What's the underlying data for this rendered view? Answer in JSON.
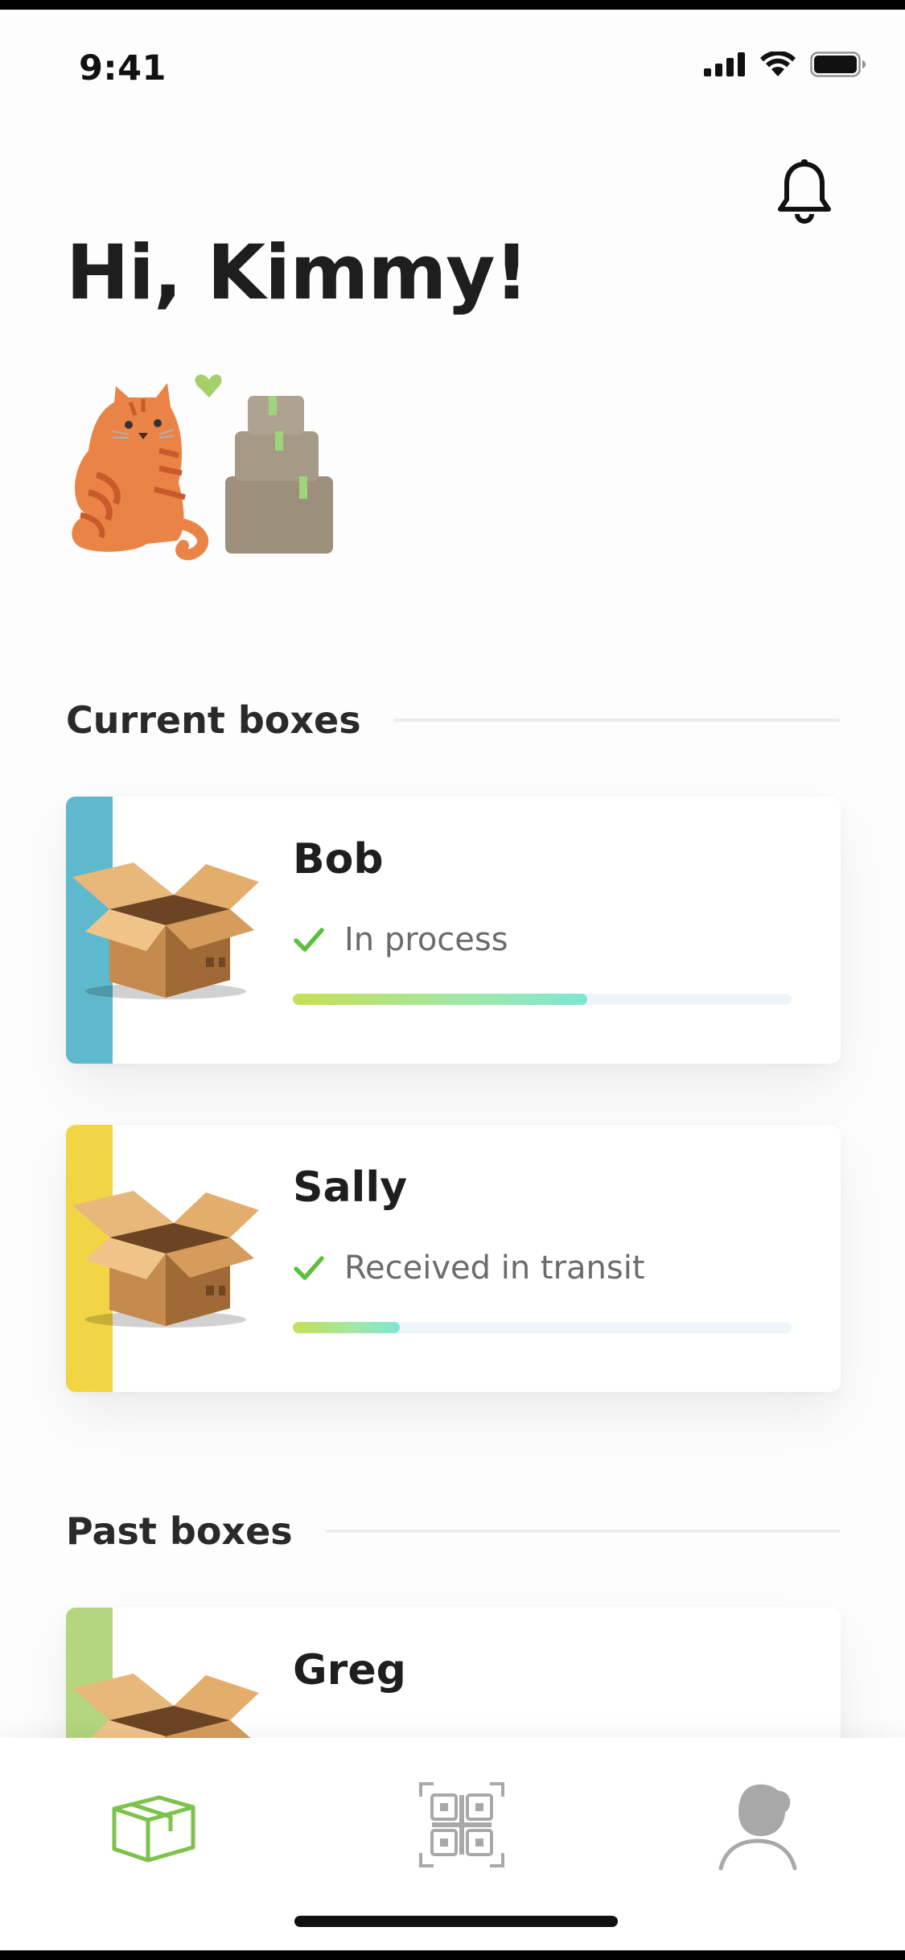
{
  "status_bar": {
    "time": "9:41",
    "icons": [
      "cellular-signal-icon",
      "wifi-icon",
      "battery-icon"
    ]
  },
  "header": {
    "greeting": "Hi, Kimmy!",
    "notification_icon": "bell-icon"
  },
  "illustration": "cat-with-boxes-illustration",
  "sections": {
    "current_title": "Current boxes",
    "past_title": "Past boxes"
  },
  "current_boxes": [
    {
      "name": "Bob",
      "status": "In process",
      "progress": 0.59,
      "accent_color": "#5fb9cc"
    },
    {
      "name": "Sally",
      "status": "Received in transit",
      "progress": 0.215,
      "accent_color": "#f2d544"
    }
  ],
  "past_boxes": [
    {
      "name": "Greg",
      "accent_color": "#b4d67e"
    }
  ],
  "tab_bar": {
    "items": [
      {
        "icon": "box-icon",
        "active": true
      },
      {
        "icon": "qr-code-icon",
        "active": false
      },
      {
        "icon": "profile-icon",
        "active": false
      }
    ],
    "active_color": "#7cc24b",
    "inactive_color": "#a8a8a8"
  },
  "colors": {
    "check": "#5cbf3e",
    "progress_gradient": [
      "#c6df54",
      "#9fe8a8",
      "#7fe6d2"
    ]
  }
}
